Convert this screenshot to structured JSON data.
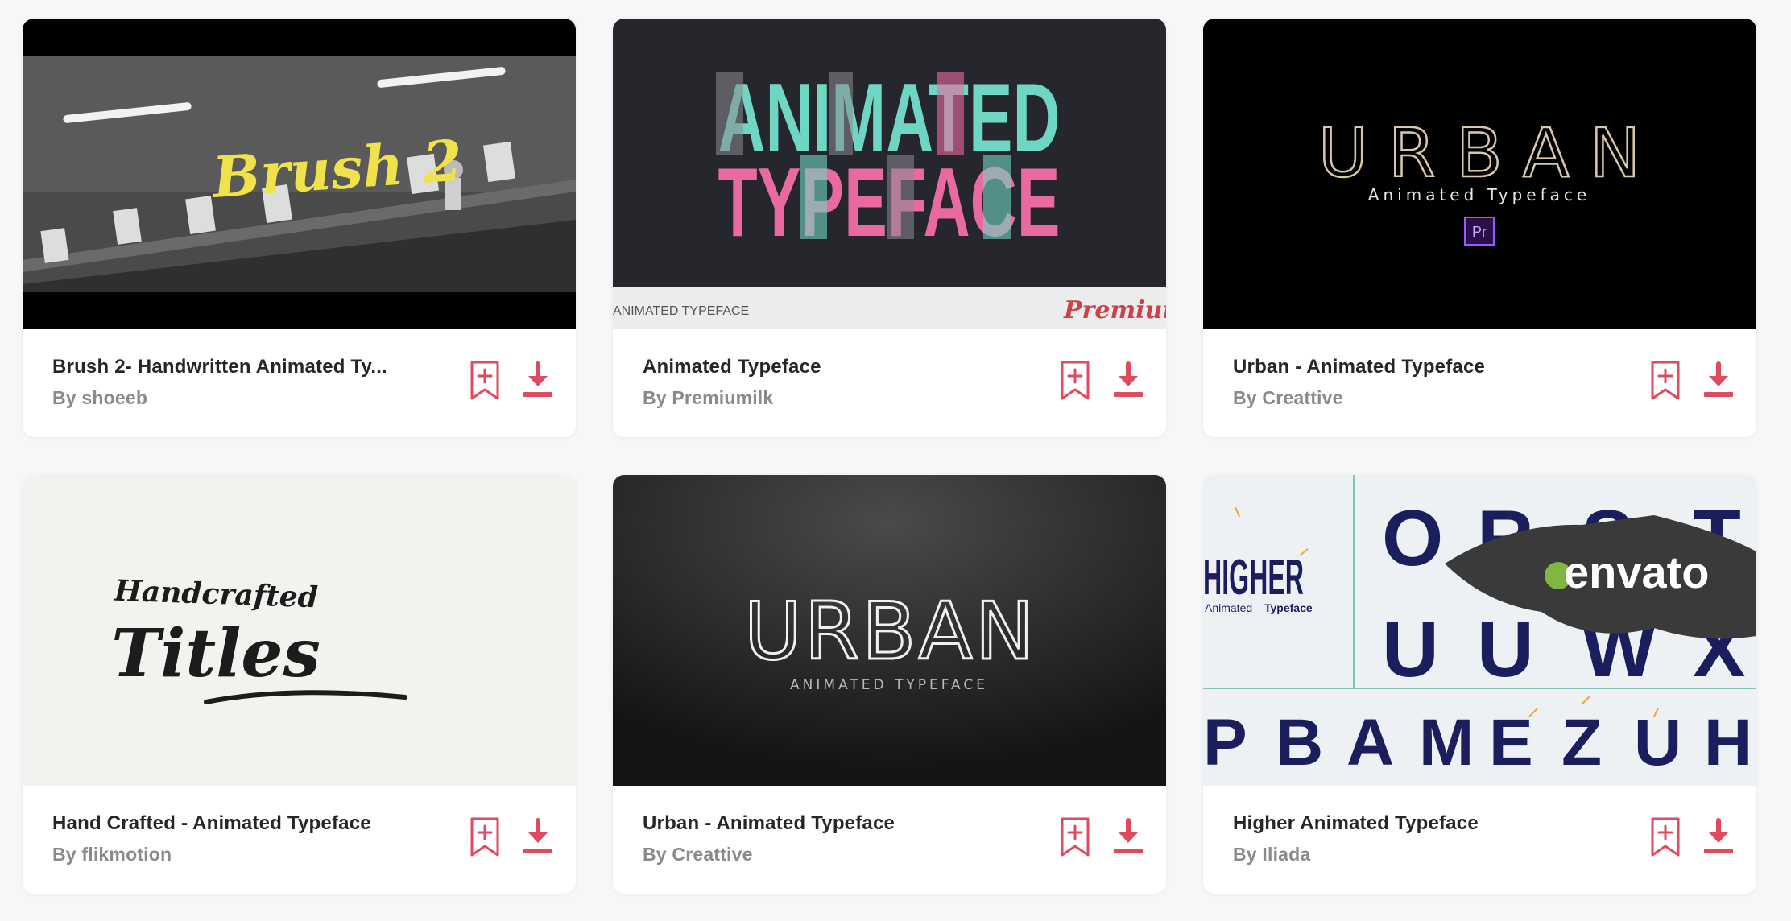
{
  "colors": {
    "accent": "#e04a5f",
    "title": "#262626",
    "author": "#8a8a8a"
  },
  "icons": {
    "bookmark": "bookmark-add-icon",
    "download": "download-icon"
  },
  "cards": [
    {
      "title": "Brush 2- Handwritten Animated Ty...",
      "author": "By shoeeb",
      "thumb": {
        "script_text": "Brush 2"
      }
    },
    {
      "title": "Animated Typeface",
      "author": "By Premiumilk",
      "thumb": {
        "line1": "ANIMATED",
        "line2": "TYPEFACE",
        "footer_left": "ANIMATED TYPEFACE",
        "footer_right": "Premiumilk"
      }
    },
    {
      "title": "Urban - Animated Typeface",
      "author": "By Creattive",
      "thumb": {
        "headline": "URBAN",
        "subtitle": "Animated Typeface",
        "badge": "Pr"
      }
    },
    {
      "title": "Hand Crafted - Animated Typeface",
      "author": "By flikmotion",
      "thumb": {
        "line1": "Handcrafted",
        "line2": "Titles"
      }
    },
    {
      "title": "Urban - Animated Typeface",
      "author": "By Creattive",
      "thumb": {
        "headline": "URBAN",
        "subtitle": "ANIMATED TYPEFACE"
      }
    },
    {
      "title": "Higher Animated Typeface",
      "author": "By Iliada",
      "thumb": {
        "headline": "HIGHER",
        "subtitle1": "Animated",
        "subtitle2": "Typeface",
        "watermark": "envato",
        "letters_top": [
          "O",
          "R",
          "S",
          "T"
        ],
        "letters_mid": [
          "U",
          "U",
          "W",
          "X"
        ],
        "letters_bottom": [
          "P",
          "B",
          "A",
          "M",
          "E",
          "Z",
          "U",
          "H"
        ]
      }
    }
  ]
}
